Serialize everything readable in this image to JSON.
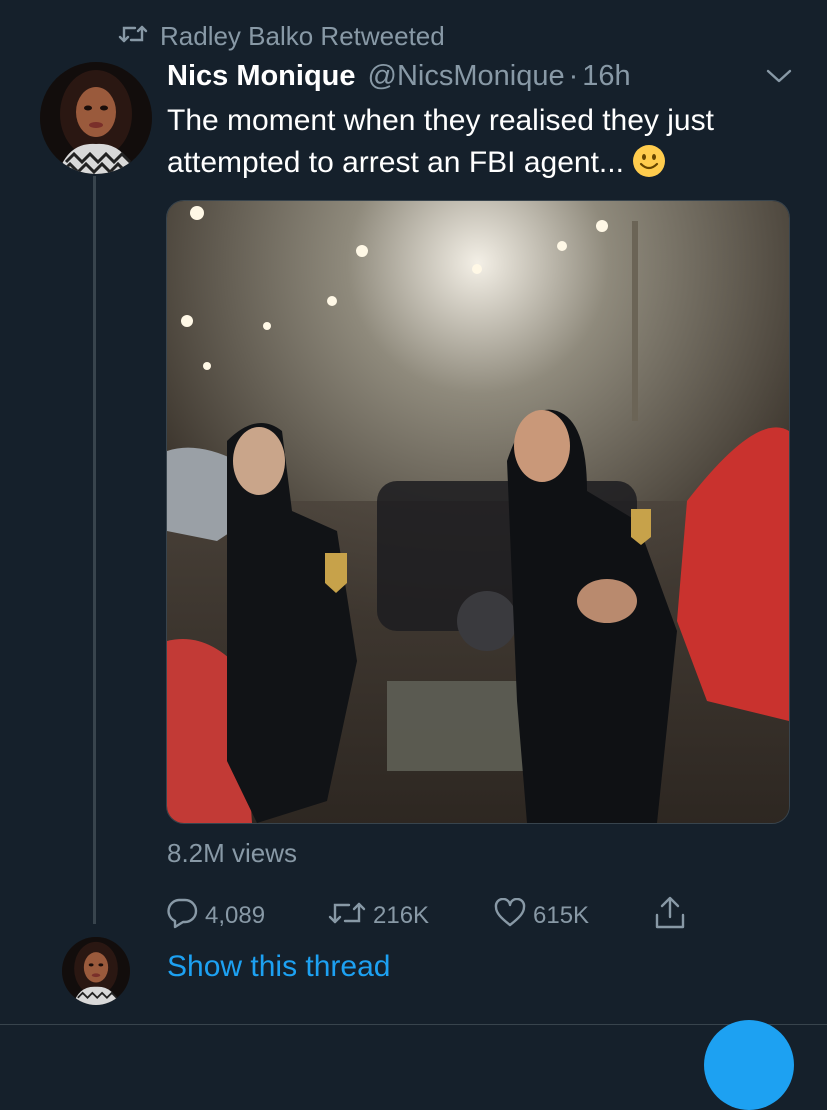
{
  "retweet_context": {
    "text": "Radley Balko Retweeted",
    "icon": "retweet-icon"
  },
  "tweet": {
    "display_name": "Nics Monique",
    "handle": "@NicsMonique",
    "separator": "·",
    "time": "16h",
    "text": "The moment when they realised they just attempted to arrest an FBI agent...",
    "emoji": "slightly-smiling-face",
    "views": "8.2M views",
    "reply_count": "4,089",
    "retweet_count": "216K",
    "like_count": "615K"
  },
  "thread_link": "Show this thread",
  "colors": {
    "background": "#15202b",
    "text_primary": "#ffffff",
    "text_secondary": "#8899a6",
    "accent": "#1da1f2",
    "divider": "#38444d"
  }
}
